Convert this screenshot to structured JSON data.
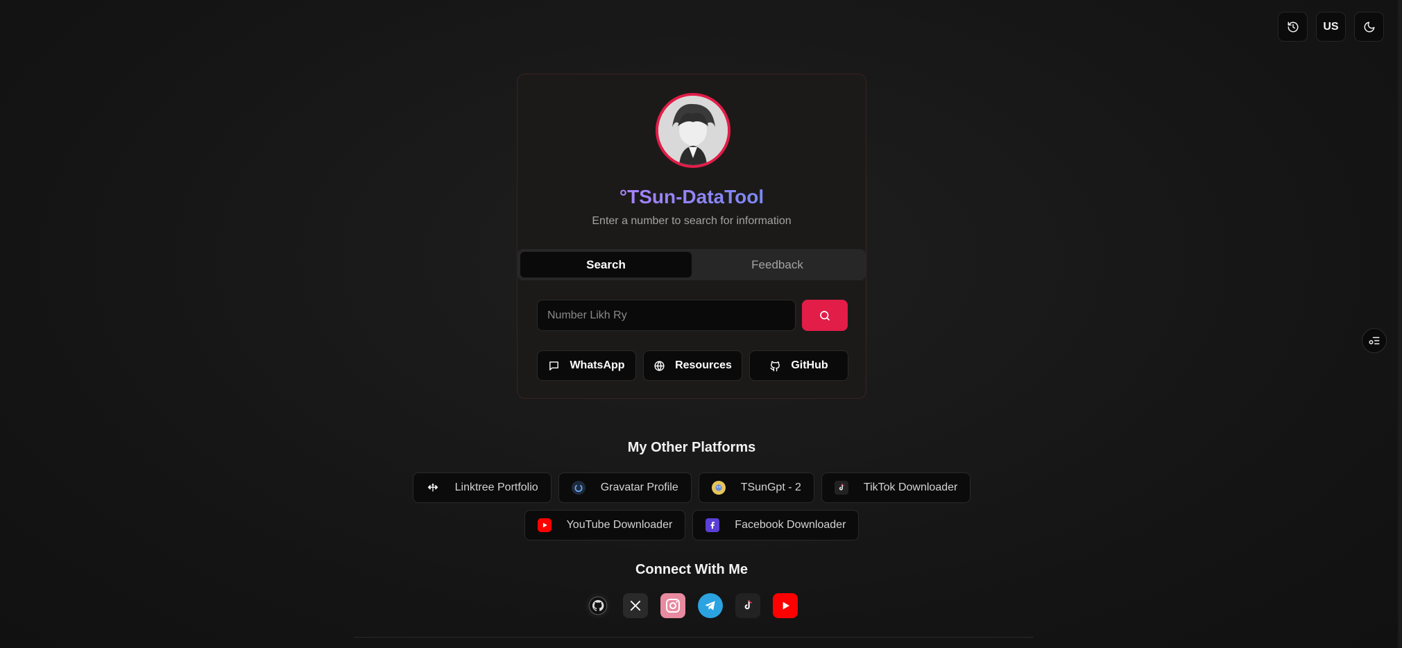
{
  "header": {
    "history_label": "history",
    "region_label": "US",
    "theme_label": "dark mode"
  },
  "profile": {
    "title": "°TSun-DataTool",
    "subtitle": "Enter a number to search for information"
  },
  "tabs": [
    {
      "label": "Search",
      "active": true
    },
    {
      "label": "Feedback",
      "active": false
    }
  ],
  "search": {
    "placeholder": "Number Likh Ry",
    "value": ""
  },
  "links": [
    {
      "label": "WhatsApp",
      "icon": "message-icon"
    },
    {
      "label": "Resources",
      "icon": "globe-icon"
    },
    {
      "label": "GitHub",
      "icon": "github-icon"
    }
  ],
  "platforms": {
    "title": "My Other Platforms",
    "row1": [
      {
        "label": "Linktree Portfolio",
        "icon": "linktree-icon"
      },
      {
        "label": "Gravatar Profile",
        "icon": "gravatar-icon"
      },
      {
        "label": "TSunGpt - 2",
        "icon": "tsungpt-icon"
      },
      {
        "label": "TikTok Downloader",
        "icon": "tiktok-icon"
      }
    ],
    "row2": [
      {
        "label": "YouTube Downloader",
        "icon": "youtube-icon"
      },
      {
        "label": "Facebook Downloader",
        "icon": "facebook-icon"
      }
    ]
  },
  "connect": {
    "title": "Connect With Me",
    "socials": [
      "github-icon",
      "x-icon",
      "instagram-icon",
      "telegram-icon",
      "tiktok-icon",
      "youtube-icon"
    ]
  },
  "colors": {
    "accent": "#e11d48",
    "background": "#141414"
  }
}
